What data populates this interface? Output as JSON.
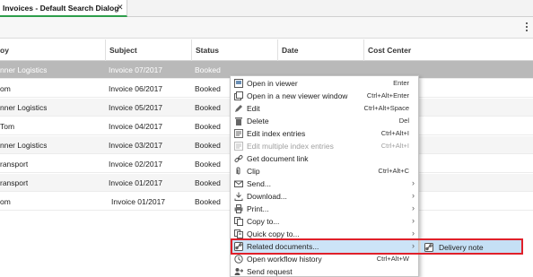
{
  "tab": {
    "title": "Invoices - Default Search Dialog",
    "close": "✕"
  },
  "columns": [
    "oy",
    "Subject",
    "Status",
    "Date",
    "Cost Center"
  ],
  "rows": [
    {
      "from": "nner Logistics",
      "subject": "Invoice 07/2017",
      "status": "Booked"
    },
    {
      "from": "om",
      "subject": "Invoice 06/2017",
      "status": "Booked"
    },
    {
      "from": "nner Logistics",
      "subject": "Invoice 05/2017",
      "status": "Booked"
    },
    {
      "from": "Tom",
      "subject": "Invoice 04/2017",
      "status": "Booked"
    },
    {
      "from": "nner Logistics",
      "subject": "Invoice 03/2017",
      "status": "Booked"
    },
    {
      "from": "ransport",
      "subject": "Invoice 02/2017",
      "status": "Booked"
    },
    {
      "from": "ransport",
      "subject": "Invoice 01/2017",
      "status": "Booked"
    },
    {
      "from": "om",
      "subject": "Invoice 01/2017",
      "status": "Booked"
    }
  ],
  "menu": [
    {
      "label": "Open in viewer",
      "shortcut": "Enter",
      "icon": "viewer-icon"
    },
    {
      "label": "Open in a new viewer window",
      "shortcut": "Ctrl+Alt+Enter",
      "icon": "new-window-icon"
    },
    {
      "label": "Edit",
      "shortcut": "Ctrl+Alt+Space",
      "icon": "pencil-icon"
    },
    {
      "label": "Delete",
      "shortcut": "Del",
      "icon": "trash-icon"
    },
    {
      "label": "Edit index entries",
      "shortcut": "Ctrl+Alt+I",
      "icon": "index-icon"
    },
    {
      "label": "Edit multiple index entries",
      "shortcut": "Ctrl+Alt+I",
      "icon": "multi-index-icon",
      "disabled": true
    },
    {
      "label": "Get document link",
      "shortcut": "",
      "icon": "link-icon"
    },
    {
      "label": "Clip",
      "shortcut": "Ctrl+Alt+C",
      "icon": "clip-icon"
    },
    {
      "label": "Send...",
      "shortcut": "",
      "icon": "send-icon",
      "submenu": true
    },
    {
      "label": "Download...",
      "shortcut": "",
      "icon": "download-icon",
      "submenu": true
    },
    {
      "label": "Print...",
      "shortcut": "",
      "icon": "print-icon",
      "submenu": true
    },
    {
      "label": "Copy to...",
      "shortcut": "",
      "icon": "copy-icon",
      "submenu": true
    },
    {
      "label": "Quick copy to...",
      "shortcut": "",
      "icon": "quick-copy-icon",
      "submenu": true
    },
    {
      "label": "Related documents...",
      "shortcut": "",
      "icon": "related-icon",
      "submenu": true,
      "highlighted": true
    },
    {
      "label": "Open workflow history",
      "shortcut": "Ctrl+Alt+W",
      "icon": "workflow-icon"
    },
    {
      "label": "Send request",
      "shortcut": "",
      "icon": "request-icon"
    }
  ],
  "submenu": {
    "label": "Delivery note",
    "icon": "related-doc-icon"
  },
  "colors": {
    "accent": "#2e9e4b",
    "selected_row": "#b9b9b9",
    "menu_highlight": "#cce4f7",
    "annotation": "#e0202a"
  }
}
